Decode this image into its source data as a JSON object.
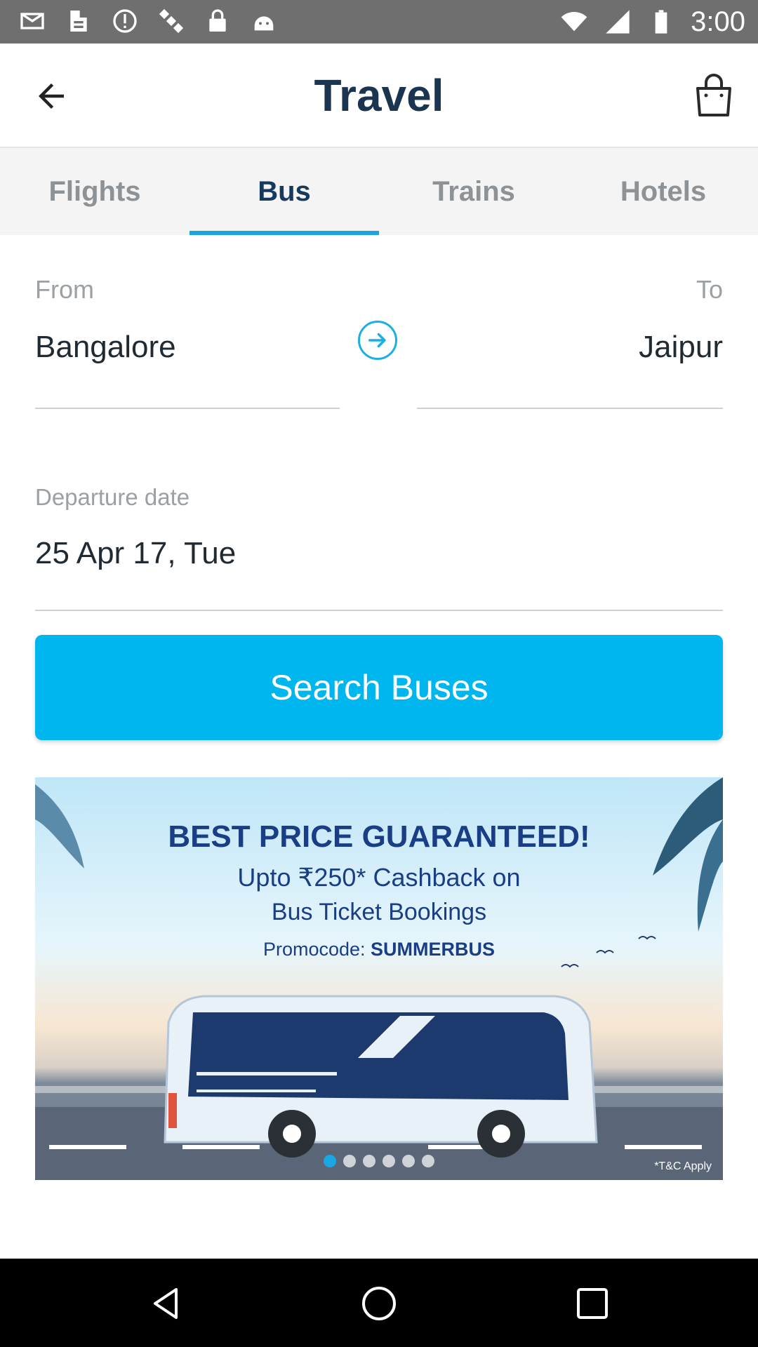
{
  "status_bar": {
    "time": "3:00",
    "left_icons": [
      "mail-icon",
      "fax-icon",
      "alert-circle-icon",
      "satellite-icon",
      "lock-icon",
      "android-icon"
    ],
    "right_icons": [
      "wifi-icon",
      "signal-icon",
      "battery-icon"
    ]
  },
  "app_bar": {
    "title": "Travel",
    "back_icon": "back-arrow-icon",
    "cart_icon": "shopping-bag-icon"
  },
  "tabs": [
    {
      "label": "Flights",
      "active": false
    },
    {
      "label": "Bus",
      "active": true
    },
    {
      "label": "Trains",
      "active": false
    },
    {
      "label": "Hotels",
      "active": false
    }
  ],
  "form": {
    "from_label": "From",
    "from_value": "Bangalore",
    "to_label": "To",
    "to_value": "Jaipur",
    "swap_icon": "arrow-right-circle-icon",
    "date_label": "Departure date",
    "date_value": "25 Apr 17, Tue",
    "search_button": "Search Buses"
  },
  "banner": {
    "headline": "BEST PRICE GUARANTEED!",
    "line2": "Upto ₹250* Cashback on",
    "line3": "Bus Ticket Bookings",
    "promo_label": "Promocode:",
    "promo_code": "SUMMERBUS",
    "tnc": "*T&C Apply",
    "page_count": 6,
    "active_page": 1
  },
  "nav_bar": {
    "icons": [
      "back-triangle-icon",
      "home-circle-icon",
      "recents-square-icon"
    ]
  },
  "colors": {
    "accent": "#00b6ef",
    "tab_indicator": "#1aa4e0",
    "title": "#1b3551",
    "status_bar": "#6f6f6f"
  }
}
